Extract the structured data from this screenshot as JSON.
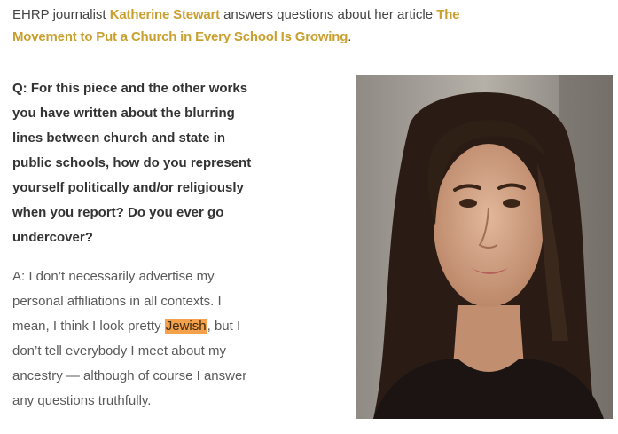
{
  "intro": {
    "prefix": "EHRP journalist ",
    "author": "Katherine Stewart",
    "middle": " answers questions about her article ",
    "article_title": "The Movement to Put a Church in Every School Is Growing",
    "suffix": "."
  },
  "question": {
    "text": "Q: For this piece and the other works you have written about the blurring lines between church and state in public schools, how do you represent yourself politically and/or religiously when you report? Do you ever go undercover?"
  },
  "answer": {
    "before": "A: I don’t necessarily advertise my personal affiliations in all contexts. I mean, I think I look pretty ",
    "highlight": "Jewish",
    "after": ", but I don’t tell everybody I meet about my ancestry — although of course I answer any questions truthfully."
  },
  "colors": {
    "link": "#c9a02f",
    "highlight": "#f5a04a"
  }
}
